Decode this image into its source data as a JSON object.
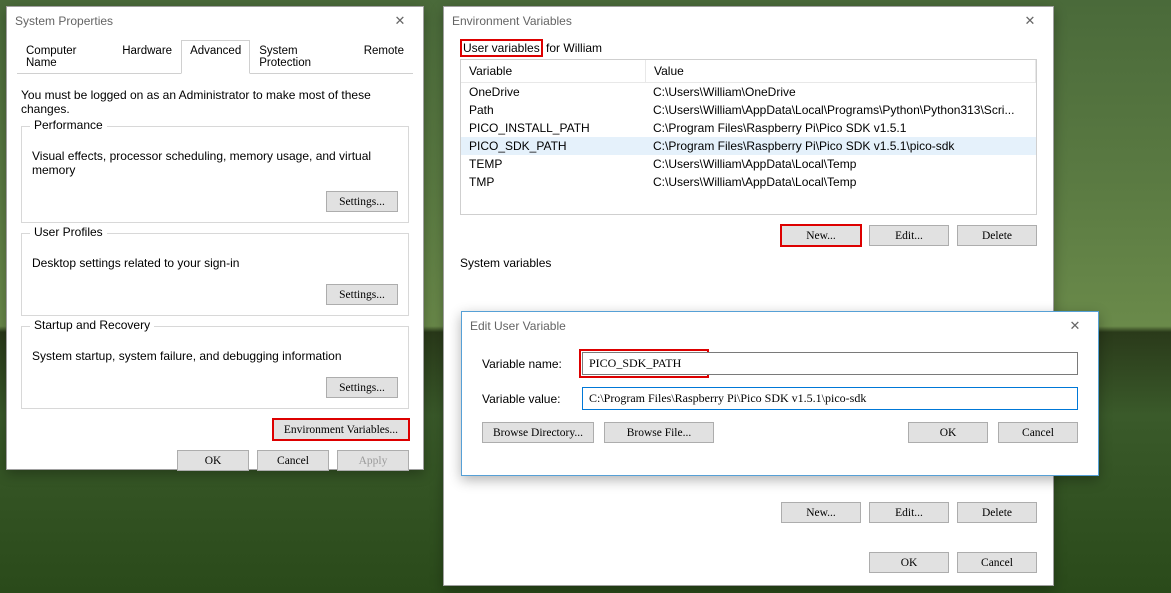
{
  "sys": {
    "title": "System Properties",
    "tabs": [
      "Computer Name",
      "Hardware",
      "Advanced",
      "System Protection",
      "Remote"
    ],
    "note": "You must be logged on as an Administrator to make most of these changes.",
    "groups": {
      "perf": {
        "label": "Performance",
        "desc": "Visual effects, processor scheduling, memory usage, and virtual memory",
        "btn": "Settings..."
      },
      "prof": {
        "label": "User Profiles",
        "desc": "Desktop settings related to your sign-in",
        "btn": "Settings..."
      },
      "start": {
        "label": "Startup and Recovery",
        "desc": "System startup, system failure, and debugging information",
        "btn": "Settings..."
      }
    },
    "envbtn": "Environment Variables...",
    "ok": "OK",
    "cancel": "Cancel",
    "apply": "Apply"
  },
  "env": {
    "title": "Environment Variables",
    "user_section": {
      "prefix": "User variables",
      "suffix": " for William"
    },
    "th_var": "Variable",
    "th_val": "Value",
    "user_rows": [
      {
        "v": "OneDrive",
        "val": "C:\\Users\\William\\OneDrive"
      },
      {
        "v": "Path",
        "val": "C:\\Users\\William\\AppData\\Local\\Programs\\Python\\Python313\\Scri..."
      },
      {
        "v": "PICO_INSTALL_PATH",
        "val": "C:\\Program Files\\Raspberry Pi\\Pico SDK v1.5.1"
      },
      {
        "v": "PICO_SDK_PATH",
        "val": "C:\\Program Files\\Raspberry Pi\\Pico SDK v1.5.1\\pico-sdk"
      },
      {
        "v": "TEMP",
        "val": "C:\\Users\\William\\AppData\\Local\\Temp"
      },
      {
        "v": "TMP",
        "val": "C:\\Users\\William\\AppData\\Local\\Temp"
      }
    ],
    "sys_section": "System variables",
    "new": "New...",
    "edit": "Edit...",
    "del": "Delete",
    "ok": "OK",
    "cancel": "Cancel"
  },
  "ed": {
    "title": "Edit User Variable",
    "name_lbl": "Variable name:",
    "name_val": "PICO_SDK_PATH",
    "value_lbl": "Variable value:",
    "value_val": "C:\\Program Files\\Raspberry Pi\\Pico SDK v1.5.1\\pico-sdk",
    "browse_dir": "Browse Directory...",
    "browse_file": "Browse File...",
    "ok": "OK",
    "cancel": "Cancel"
  }
}
